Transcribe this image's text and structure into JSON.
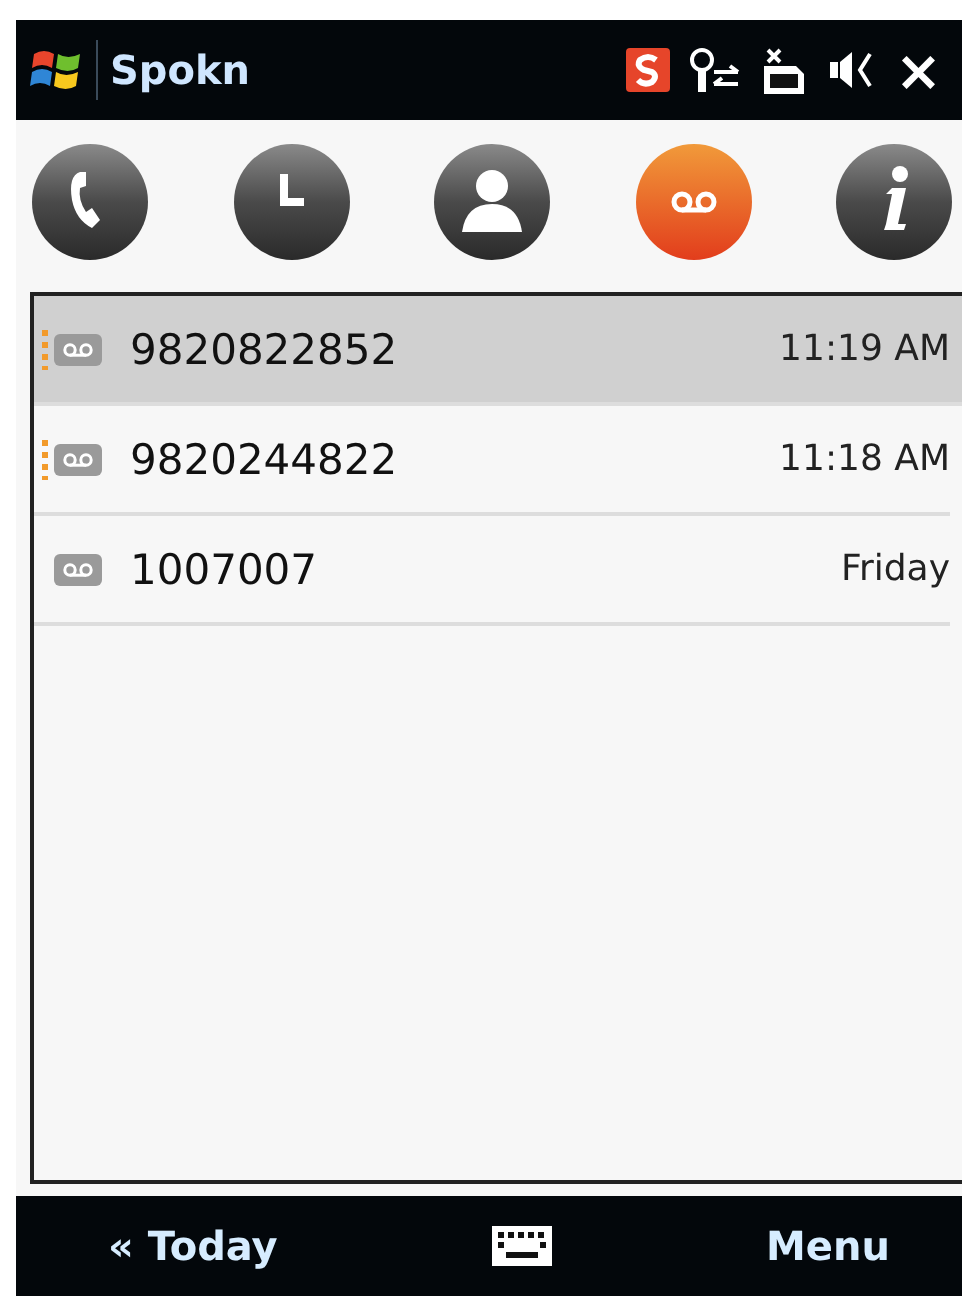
{
  "title_bar": {
    "title": "Spokn",
    "close": "×"
  },
  "tabs": [
    {
      "kind": "phone",
      "selected": false
    },
    {
      "kind": "clock",
      "selected": false
    },
    {
      "kind": "contact",
      "selected": false
    },
    {
      "kind": "voicemail",
      "selected": true
    },
    {
      "kind": "info",
      "selected": false
    }
  ],
  "messages": [
    {
      "number": "9820822852",
      "time": "11:19 AM",
      "unread": true,
      "selected": true
    },
    {
      "number": "9820244822",
      "time": "11:18 AM",
      "unread": true,
      "selected": false
    },
    {
      "number": "1007007",
      "time": "Friday",
      "unread": false,
      "selected": false
    }
  ],
  "soft_keys": {
    "left": "« Today",
    "right": "Menu"
  }
}
